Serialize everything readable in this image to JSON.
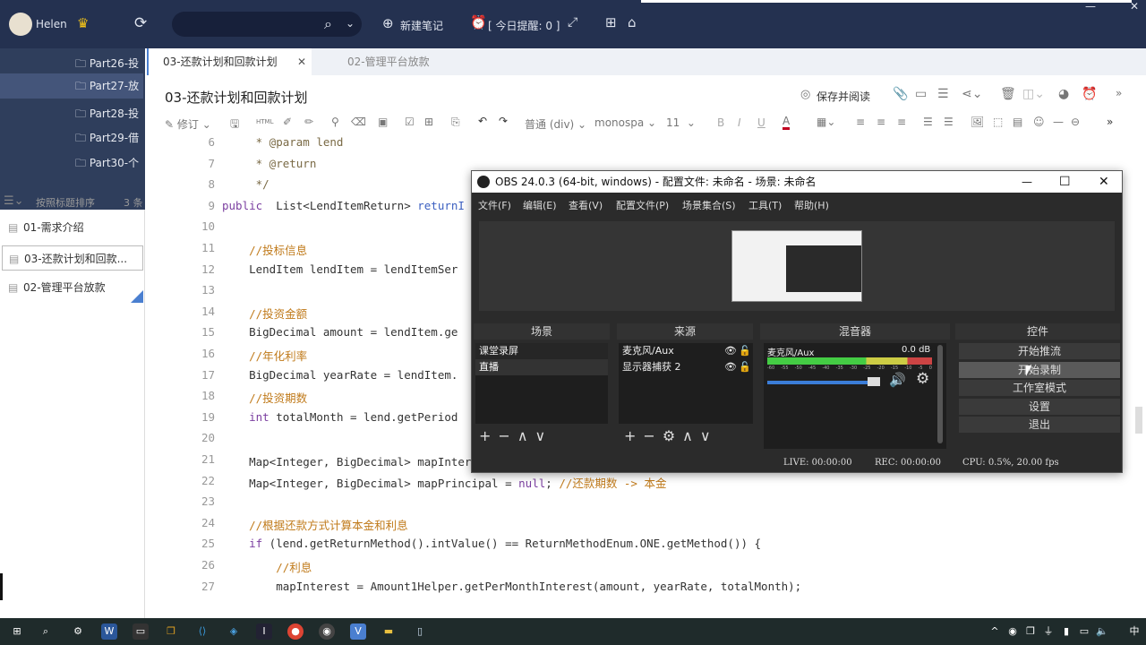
{
  "topbar": {
    "user": "Helen",
    "new_note": "新建笔记",
    "reminder": "[ 今日提醒: 0 ]",
    "search_placeholder": ""
  },
  "sidebar": {
    "folders": [
      "Part26-投",
      "Part27-放",
      "Part28-投",
      "Part29-借",
      "Part30-个"
    ],
    "selected_folder": 1,
    "sort_label": "按照标题排序",
    "count": "3 条",
    "notes": [
      "01-需求介绍",
      "03-还款计划和回款...",
      "02-管理平台放款"
    ],
    "selected_note": 1
  },
  "tabs": [
    {
      "label": "03-还款计划和回款计划",
      "active": true
    },
    {
      "label": "02-管理平台放款",
      "active": false
    }
  ],
  "note": {
    "title": "03-还款计划和回款计划",
    "save_read": "保存并阅读"
  },
  "toolbar": {
    "revise": "修订",
    "html": "HTML",
    "block": "普通 (div)",
    "font": "monospa",
    "size": "11",
    "bold": "B",
    "italic": "I",
    "underline": "U"
  },
  "code": [
    {
      "n": "6",
      "t": [
        [
          "jd",
          "     * @param lend"
        ]
      ]
    },
    {
      "n": "7",
      "t": [
        [
          "jd",
          "     * @return"
        ]
      ]
    },
    {
      "n": "8",
      "t": [
        [
          "jd",
          "     */"
        ]
      ]
    },
    {
      "n": "9",
      "t": [
        [
          "kw",
          "public"
        ],
        [
          "",
          "  List<LendItemReturn> "
        ],
        [
          "fn",
          "returnI"
        ]
      ]
    },
    {
      "n": "10",
      "t": []
    },
    {
      "n": "11",
      "t": [
        [
          "cm",
          "    //投标信息"
        ]
      ]
    },
    {
      "n": "12",
      "t": [
        [
          "",
          "    LendItem lendItem = lendItemSer"
        ]
      ]
    },
    {
      "n": "13",
      "t": []
    },
    {
      "n": "14",
      "t": [
        [
          "cm",
          "    //投资金额"
        ]
      ]
    },
    {
      "n": "15",
      "t": [
        [
          "",
          "    BigDecimal amount = lendItem.ge"
        ]
      ]
    },
    {
      "n": "16",
      "t": [
        [
          "cm",
          "    //年化利率"
        ]
      ]
    },
    {
      "n": "17",
      "t": [
        [
          "",
          "    BigDecimal yearRate = lendItem."
        ]
      ]
    },
    {
      "n": "18",
      "t": [
        [
          "cm",
          "    //投资期数"
        ]
      ]
    },
    {
      "n": "19",
      "t": [
        [
          "kw",
          "    int"
        ],
        [
          "",
          " totalMonth = lend.getPeriod"
        ]
      ]
    },
    {
      "n": "20",
      "t": []
    },
    {
      "n": "21",
      "t": [
        [
          "",
          "    Map<Integer, BigDecimal> mapInterest = "
        ],
        [
          "kw",
          "null"
        ],
        [
          "",
          "; "
        ],
        [
          "cm",
          " //还款期数 -> 利息"
        ]
      ]
    },
    {
      "n": "22",
      "t": [
        [
          "",
          "    Map<Integer, BigDecimal> mapPrincipal = "
        ],
        [
          "kw",
          "null"
        ],
        [
          "",
          "; "
        ],
        [
          "cm",
          "//还款期数 -> 本金"
        ]
      ]
    },
    {
      "n": "23",
      "t": []
    },
    {
      "n": "24",
      "t": [
        [
          "cm",
          "    //根据还款方式计算本金和利息"
        ]
      ]
    },
    {
      "n": "25",
      "t": [
        [
          "kw",
          "    if"
        ],
        [
          "",
          " (lend.getReturnMethod().intValue() == ReturnMethodEnum.ONE.getMethod()) {"
        ]
      ]
    },
    {
      "n": "26",
      "t": [
        [
          "cm",
          "        //利息"
        ]
      ]
    },
    {
      "n": "27",
      "t": [
        [
          "",
          "        mapInterest = Amount1Helper.getPerMonthInterest(amount, yearRate, totalMonth);"
        ]
      ]
    }
  ],
  "obs": {
    "title": "OBS 24.0.3 (64-bit, windows) - 配置文件: 未命名 - 场景: 未命名",
    "menu": [
      "文件(F)",
      "编辑(E)",
      "查看(V)",
      "配置文件(P)",
      "场景集合(S)",
      "工具(T)",
      "帮助(H)"
    ],
    "docks": {
      "scenes": "场景",
      "sources": "来源",
      "mixer": "混音器",
      "controls": "控件"
    },
    "scenes": [
      "课堂录屏",
      "直播"
    ],
    "selected_scene": 1,
    "sources": [
      "麦克风/Aux",
      "显示器捕获 2"
    ],
    "mixer": {
      "channel": "麦克风/Aux",
      "db": "0.0 dB",
      "scale": [
        "-60",
        "-55",
        "-50",
        "-45",
        "-40",
        "-35",
        "-30",
        "-25",
        "-20",
        "-15",
        "-10",
        "-5",
        "0"
      ],
      "volume": 0.85
    },
    "controls": [
      "开始推流",
      "开始录制",
      "工作室模式",
      "设置",
      "退出"
    ],
    "hover_control": 1,
    "status": {
      "live": "LIVE: 00:00:00",
      "rec": "REC: 00:00:00",
      "cpu": "CPU: 0.5%, 20.00 fps"
    }
  },
  "taskbar": {
    "ime": "中"
  }
}
